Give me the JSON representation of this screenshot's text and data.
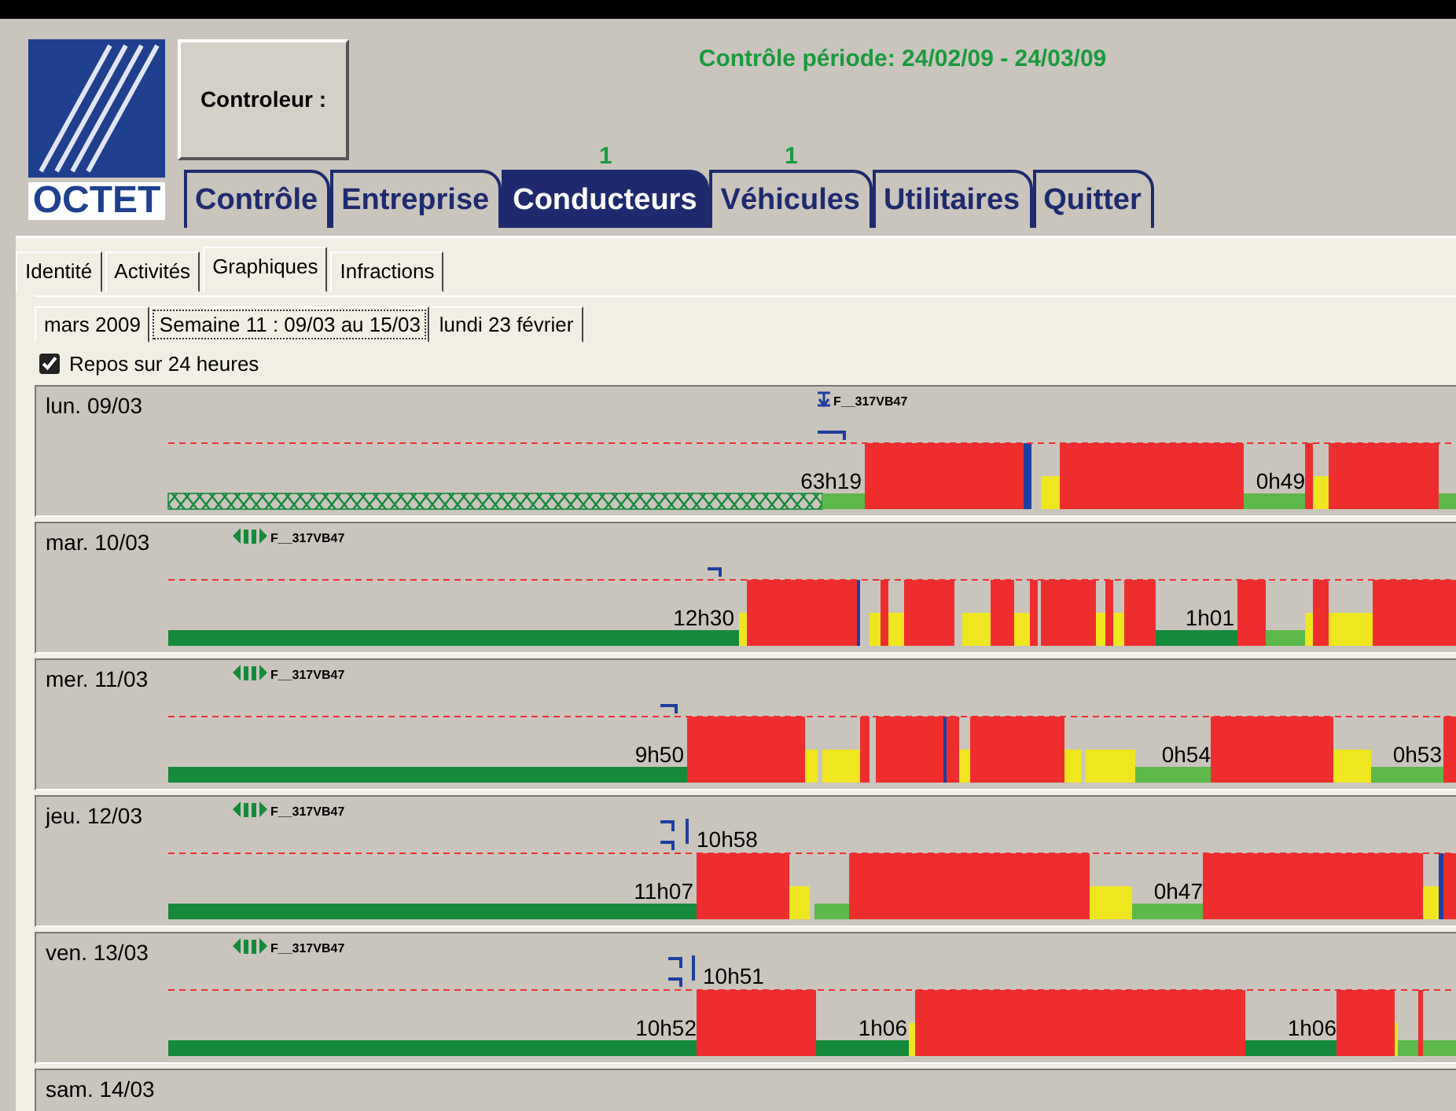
{
  "header": {
    "logo": "OCTET",
    "controller_button": "Controleur :",
    "period": "Contrôle période: 24/02/09 - 24/03/09"
  },
  "main_tabs": [
    {
      "label": "Contrôle",
      "selected": false
    },
    {
      "label": "Entreprise",
      "selected": false
    },
    {
      "label": "Conducteurs",
      "selected": true,
      "count": "1"
    },
    {
      "label": "Véhicules",
      "selected": false,
      "count": "1"
    },
    {
      "label": "Utilitaires",
      "selected": false
    },
    {
      "label": "Quitter",
      "selected": false
    }
  ],
  "sub_tabs": [
    {
      "label": "Identité",
      "selected": false
    },
    {
      "label": "Activités",
      "selected": false
    },
    {
      "label": "Graphiques",
      "selected": true
    },
    {
      "label": "Infractions",
      "selected": false
    }
  ],
  "period_tabs": [
    {
      "label": "mars 2009",
      "selected": false
    },
    {
      "label": "Semaine 11 : 09/03 au 15/03",
      "selected": true
    },
    {
      "label": "lundi 23 février",
      "selected": false
    }
  ],
  "rest_option": {
    "label": "Repos sur 24 heures",
    "checked": true
  },
  "days": [
    {
      "label": "lun. 09/03",
      "vehicle": {
        "kind": "insert",
        "text": "F__317VB47"
      },
      "durations": [
        "63h19",
        "0h49"
      ]
    },
    {
      "label": "mar. 10/03",
      "vehicle": {
        "kind": "card",
        "text": "F__317VB47"
      },
      "durations": [
        "12h30",
        "1h01"
      ]
    },
    {
      "label": "mer. 11/03",
      "vehicle": {
        "kind": "card",
        "text": "F__317VB47"
      },
      "durations": [
        "9h50",
        "0h54",
        "0h53"
      ]
    },
    {
      "label": "jeu. 12/03",
      "vehicle": {
        "kind": "card",
        "text": "F__317VB47"
      },
      "durations": [
        "10h58",
        "11h07",
        "0h47"
      ]
    },
    {
      "label": "ven. 13/03",
      "vehicle": {
        "kind": "card",
        "text": "F__317VB47"
      },
      "durations": [
        "10h51",
        "10h52",
        "1h06",
        "1h06"
      ]
    },
    {
      "label": "sam. 14/03"
    }
  ]
}
